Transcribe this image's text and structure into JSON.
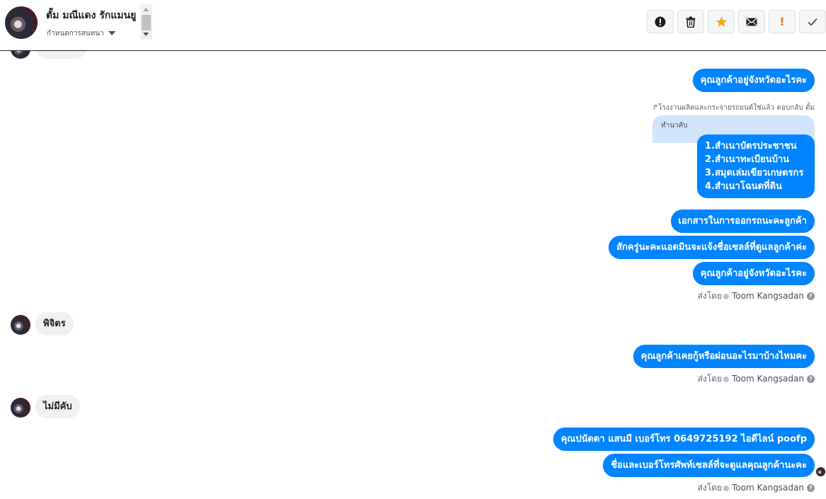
{
  "header": {
    "contact_name": "ตั้ม มณีแดง รักแมนยู",
    "subtitle": "กำหนดการสนทนา"
  },
  "toolbar": {
    "buttons": [
      {
        "name": "spam-button",
        "icon": "exclamation-circle-icon"
      },
      {
        "name": "delete-button",
        "icon": "trash-icon"
      },
      {
        "name": "star-button",
        "icon": "star-icon",
        "color": "#f5a623"
      },
      {
        "name": "mark-unread-button",
        "icon": "envelope-icon"
      },
      {
        "name": "follow-up-button",
        "icon": "exclamation-mark-icon",
        "color": "#e9710f",
        "label": "!"
      },
      {
        "name": "mark-done-button",
        "icon": "check-icon"
      }
    ]
  },
  "messages": {
    "m1": "คุณลูกค้าอยู่จังหวัดอะไรคะ",
    "reply_meta": "โรงงานผลิตและกระจายรถยนต์ใช่แล้ว ตอบกลับ ตั้ม",
    "quoted": "ทำนาคับ",
    "documents": [
      "1.สำเนาบัตรประชาชน",
      "2.สำเนาทะเบียนบ้าน",
      "3.สมุดเล่มเขียวเกษตรกร",
      "4.สำเนาโฉนดที่ดิน"
    ],
    "m3": "เอกสารในการออกรถนะคะลูกค้า",
    "m4": "สักครู่นะคะแอดมินจะแจ้งชื่อเซลล์ที่ดูแลลูกค้าค่ะ",
    "m5": "คุณลูกค้าอยู่จังหวัดอะไรคะ",
    "in1": "พิจิตร",
    "m6": "คุณลูกค้าเคยกู้หรือผ่อนอะไรมาบ้างไหมคะ",
    "in2": "ไม่มีคับ",
    "m7": "คุณปนัดดา แสนมี   เบอร์โทร 0649725192  ไอดีไลน์ poofp",
    "m8": "ชื่อและเบอร์โทรศัพท์เซลล์ที่จะดูแลคุณลูกค้านะคะ"
  },
  "sent_by": {
    "prefix": "ส่งโดย",
    "agent": "Toom Kangsadan"
  }
}
